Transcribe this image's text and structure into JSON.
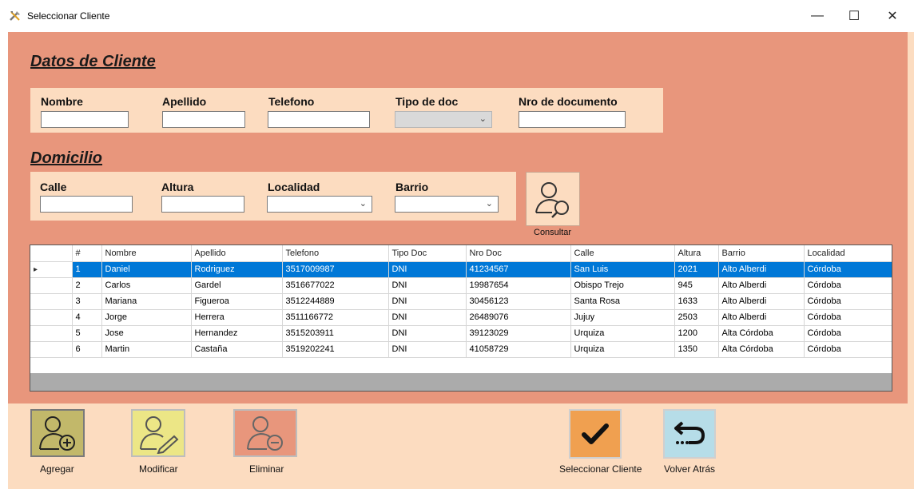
{
  "window": {
    "title": "Seleccionar Cliente",
    "minimize_glyph": "—",
    "maximize_glyph": "☐",
    "close_glyph": "✕"
  },
  "cliente": {
    "section_title": "Datos de Cliente",
    "nombre_label": "Nombre",
    "apellido_label": "Apellido",
    "telefono_label": "Telefono",
    "tipo_doc_label": "Tipo de doc",
    "nro_doc_label": "Nro de documento",
    "nombre_value": "",
    "apellido_value": "",
    "telefono_value": "",
    "tipo_doc_value": "",
    "nro_doc_value": ""
  },
  "domicilio": {
    "section_title": "Domicilio",
    "calle_label": "Calle",
    "altura_label": "Altura",
    "localidad_label": "Localidad",
    "barrio_label": "Barrio",
    "calle_value": "",
    "altura_value": "",
    "localidad_value": "",
    "barrio_value": ""
  },
  "consultar_label": "Consultar",
  "grid": {
    "columns": [
      "#",
      "Nombre",
      "Apellido",
      "Telefono",
      "Tipo Doc",
      "Nro Doc",
      "Calle",
      "Altura",
      "Barrio",
      "Localidad"
    ],
    "rows": [
      [
        "1",
        "Daniel",
        "Rodriguez",
        "3517009987",
        "DNI",
        "41234567",
        "San Luis",
        "2021",
        "Alto Alberdi",
        "Córdoba"
      ],
      [
        "2",
        "Carlos",
        "Gardel",
        "3516677022",
        "DNI",
        "19987654",
        "Obispo Trejo",
        "945",
        "Alto Alberdi",
        "Córdoba"
      ],
      [
        "3",
        "Mariana",
        "Figueroa",
        "3512244889",
        "DNI",
        "30456123",
        "Santa Rosa",
        "1633",
        "Alto Alberdi",
        "Córdoba"
      ],
      [
        "4",
        "Jorge",
        "Herrera",
        "3511166772",
        "DNI",
        "26489076",
        "Jujuy",
        "2503",
        "Alto Alberdi",
        "Córdoba"
      ],
      [
        "5",
        "Jose",
        "Hernandez",
        "3515203911",
        "DNI",
        "39123029",
        "Urquiza",
        "1200",
        "Alta Córdoba",
        "Córdoba"
      ],
      [
        "6",
        "Martin",
        "Castaña",
        "3519202241",
        "DNI",
        "41058729",
        "Urquiza",
        "1350",
        "Alta Córdoba",
        "Córdoba"
      ]
    ],
    "selected_row": 0,
    "row_indicator": "▸"
  },
  "actions": {
    "agregar": "Agregar",
    "modificar": "Modificar",
    "eliminar": "Eliminar",
    "seleccionar": "Seleccionar Cliente",
    "volver": "Volver Atrás"
  },
  "colors": {
    "panel": "#e8967c",
    "background": "#fcdcc0",
    "selection": "#0078d7",
    "agregar_btn": "#c2b86a",
    "modificar_btn": "#ece686",
    "eliminar_btn": "#e8967c",
    "seleccionar_btn": "#f0a050",
    "volver_btn": "#b6dde8"
  }
}
